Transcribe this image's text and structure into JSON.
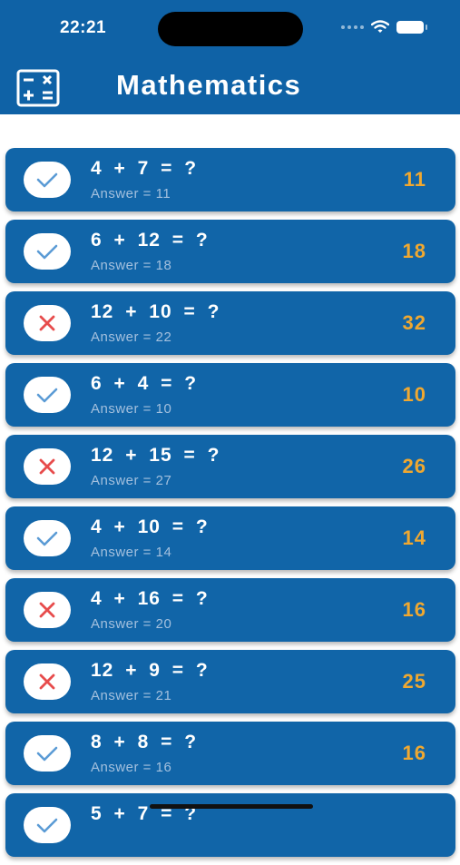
{
  "status_bar": {
    "time": "22:21"
  },
  "header": {
    "title": "Mathematics",
    "icon": "calculator-icon"
  },
  "colors": {
    "header_bg": "#0f62a6",
    "card_bg": "#1165a8",
    "correct_check": "#5b9bd5",
    "wrong_cross": "#e74c4c",
    "guess_text": "#f0a830"
  },
  "items": [
    {
      "question": "4 + 7 = ?",
      "answer": "Answer = 11",
      "guess": "11",
      "correct": true
    },
    {
      "question": "6 + 12 = ?",
      "answer": "Answer = 18",
      "guess": "18",
      "correct": true
    },
    {
      "question": "12 + 10 = ?",
      "answer": "Answer = 22",
      "guess": "32",
      "correct": false
    },
    {
      "question": "6 + 4 = ?",
      "answer": "Answer = 10",
      "guess": "10",
      "correct": true
    },
    {
      "question": "12 + 15 = ?",
      "answer": "Answer = 27",
      "guess": "26",
      "correct": false
    },
    {
      "question": "4 + 10 = ?",
      "answer": "Answer = 14",
      "guess": "14",
      "correct": true
    },
    {
      "question": "4 + 16 = ?",
      "answer": "Answer = 20",
      "guess": "16",
      "correct": false
    },
    {
      "question": "12 + 9 = ?",
      "answer": "Answer = 21",
      "guess": "25",
      "correct": false
    },
    {
      "question": "8 + 8 = ?",
      "answer": "Answer = 16",
      "guess": "16",
      "correct": true
    },
    {
      "question": "5 + 7 = ?",
      "answer": "",
      "guess": "",
      "correct": true
    }
  ]
}
